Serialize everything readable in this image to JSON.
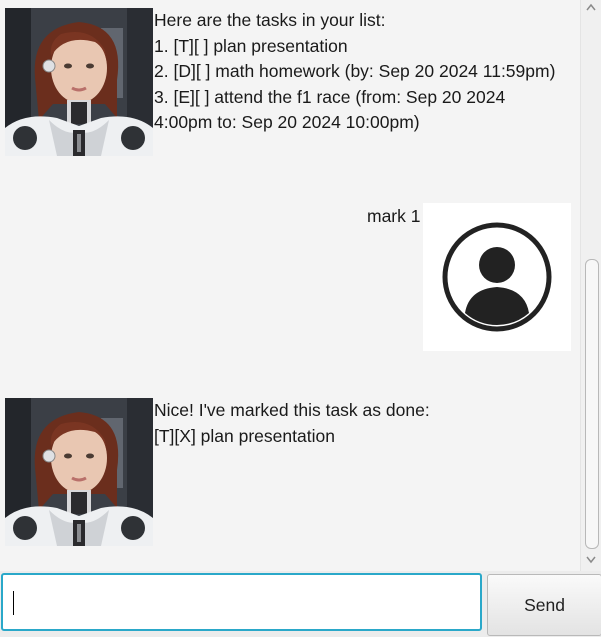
{
  "chat": {
    "messages": [
      {
        "sender": "bot",
        "avatar_icon": "robot-woman-avatar-icon",
        "lines": [
          "Here are the tasks in your list:",
          "1. [T][ ] plan presentation",
          "2. [D][ ] math homework (by: Sep 20 2024 11:59pm)",
          "3. [E][ ] attend the f1 race (from: Sep 20 2024",
          "4:00pm to: Sep 20 2024 10:00pm)"
        ]
      },
      {
        "sender": "user",
        "avatar_icon": "user-profile-icon",
        "lines": [
          "mark 1"
        ]
      },
      {
        "sender": "bot",
        "avatar_icon": "robot-woman-avatar-icon",
        "lines": [
          "Nice! I've marked this task as done:",
          "[T][X] plan presentation"
        ]
      }
    ]
  },
  "input": {
    "value": "",
    "placeholder": ""
  },
  "send_button": {
    "label": "Send"
  },
  "scrollbar": {
    "up_icon": "chevron-up-icon",
    "down_icon": "chevron-down-icon"
  }
}
